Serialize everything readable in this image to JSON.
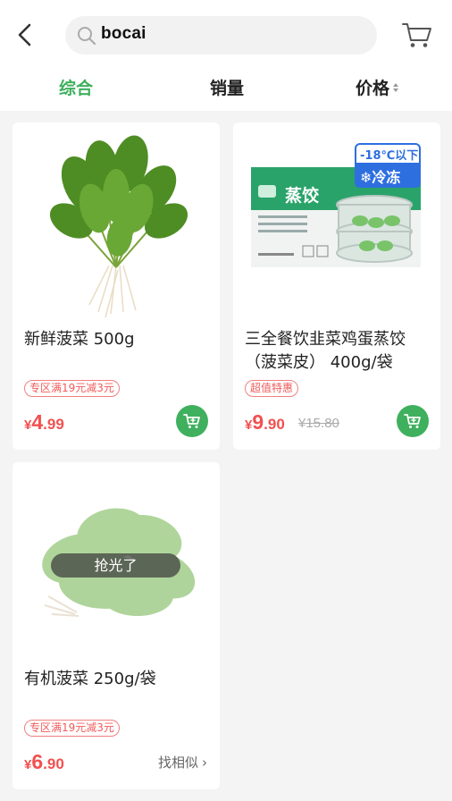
{
  "header": {
    "search_query": "bocai"
  },
  "tabs": [
    {
      "label": "综合",
      "active": true
    },
    {
      "label": "销量",
      "active": false
    },
    {
      "label": "价格",
      "active": false
    }
  ],
  "products": [
    {
      "title": "新鲜菠菜 500g",
      "tag": "专区满19元减3元",
      "price_symbol": "¥",
      "price_int": "4",
      "price_dec": ".99",
      "action": "add-to-cart"
    },
    {
      "title": "三全餐饮韭菜鸡蛋蒸饺（菠菜皮） 400g/袋",
      "tag": "超值特惠",
      "price_symbol": "¥",
      "price_int": "9",
      "price_dec": ".90",
      "original_price": "¥15.80",
      "package_text": "蒸饺",
      "badge_temp": "-18℃以下",
      "badge_frozen": "冷冻",
      "action": "add-to-cart"
    },
    {
      "title": "有机菠菜 250g/袋",
      "tag": "专区满19元减3元",
      "price_symbol": "¥",
      "price_int": "6",
      "price_dec": ".90",
      "sold_out_label": "抢光了",
      "similar_label": "找相似",
      "action": "find-similar"
    }
  ],
  "colors": {
    "brand_green": "#3fb05d",
    "price_red": "#f25050"
  }
}
